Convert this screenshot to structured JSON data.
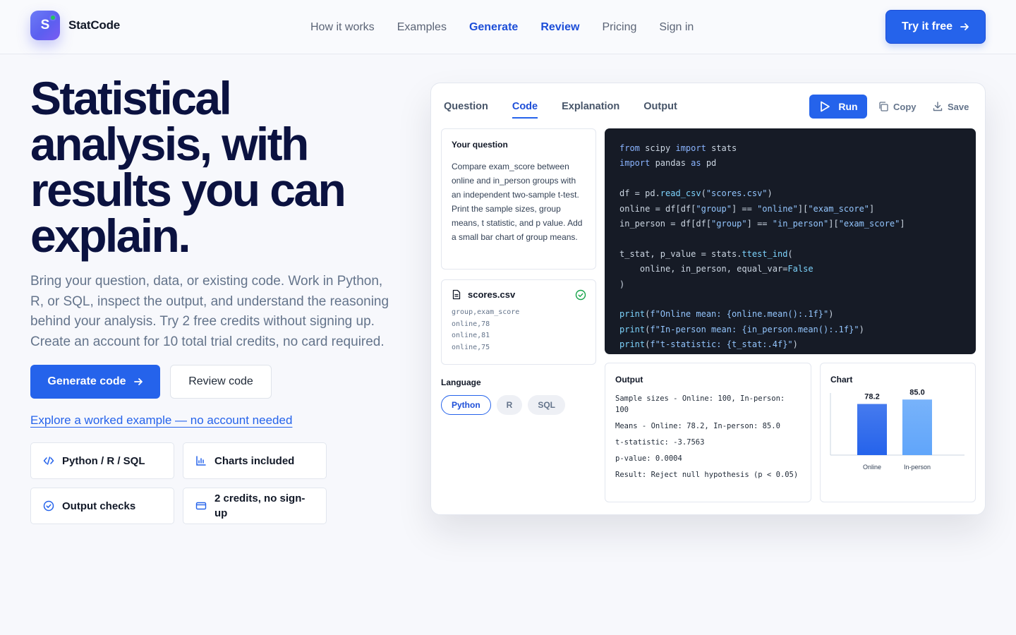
{
  "brand": {
    "name": "StatCode",
    "mark_letter": "S",
    "accent": "#2563eb"
  },
  "nav": {
    "items": [
      {
        "label": "How it works",
        "active": false
      },
      {
        "label": "Examples",
        "active": false
      },
      {
        "label": "Generate",
        "active": true
      },
      {
        "label": "Review",
        "active": true
      },
      {
        "label": "Pricing",
        "active": false
      },
      {
        "label": "Sign in",
        "active": false
      }
    ],
    "cta": "Try it free"
  },
  "hero": {
    "title_lines": [
      "Statistical",
      "analysis, with",
      "results you can",
      "explain."
    ],
    "subtitle": "Bring your question, data, or existing code. Work in Python, R, or SQL, inspect the output, and understand the reasoning behind your analysis. Try 2 free credits without signing up. Create an account for 10 total trial credits, no card required.",
    "primary_button": "Generate code",
    "secondary_button": "Review code",
    "example_link": "Explore a worked example — no account needed",
    "features": [
      {
        "label": "Python / R / SQL",
        "icon": "code-icon"
      },
      {
        "label": "Charts included",
        "icon": "bar-chart-icon"
      },
      {
        "label": "Output checks",
        "icon": "check-circle-icon"
      },
      {
        "label": "2 credits, no sign-up",
        "icon": "credit-card-icon"
      }
    ]
  },
  "panel": {
    "tabs": [
      "Question",
      "Code",
      "Explanation",
      "Output"
    ],
    "active_tab": "Code",
    "run": "Run",
    "copy": "Copy",
    "save": "Save",
    "question": {
      "label": "Your question",
      "text": "Compare exam_score between online and in_person groups with an independent two-sample t-test. Print the sample sizes, group means, t statistic, and p value. Add a small bar chart of group means."
    },
    "file": {
      "name": "scores.csv",
      "lines": [
        "group,exam_score",
        "online,78",
        "online,81",
        "online,75"
      ]
    },
    "language": {
      "label": "Language",
      "options": [
        "Python",
        "R",
        "SQL"
      ],
      "selected": "Python"
    },
    "code_lines": [
      "from scipy import stats",
      "import pandas as pd",
      "",
      "df = pd.read_csv(\"scores.csv\")",
      "online = df[df[\"group\"] == \"online\"][\"exam_score\"]",
      "in_person = df[df[\"group\"] == \"in_person\"][\"exam_score\"]",
      "",
      "t_stat, p_value = stats.ttest_ind(",
      "    online, in_person, equal_var=False",
      ")",
      "",
      "print(f\"Online mean: {online.mean():.1f}\")",
      "print(f\"In-person mean: {in_person.mean():.1f}\")",
      "print(f\"t-statistic: {t_stat:.4f}\")"
    ],
    "output": {
      "title": "Output",
      "lines": [
        "Sample sizes - Online: 100, In-person: 100",
        "Means - Online: 78.2, In-person: 85.0",
        "t-statistic: -3.7563",
        "p-value: 0.0004",
        "Result: Reject null hypothesis (p < 0.05)"
      ]
    },
    "chart": {
      "title": "Chart"
    }
  },
  "chart_data": {
    "type": "bar",
    "title": "Chart",
    "categories": [
      "Online",
      "In-person"
    ],
    "values": [
      78.2,
      85.0
    ],
    "value_labels": [
      "78.2",
      "85.0"
    ],
    "ylim": [
      0,
      95
    ],
    "colors": [
      "#2563eb",
      "#60a5fa"
    ],
    "grid": false,
    "legend": "none"
  }
}
